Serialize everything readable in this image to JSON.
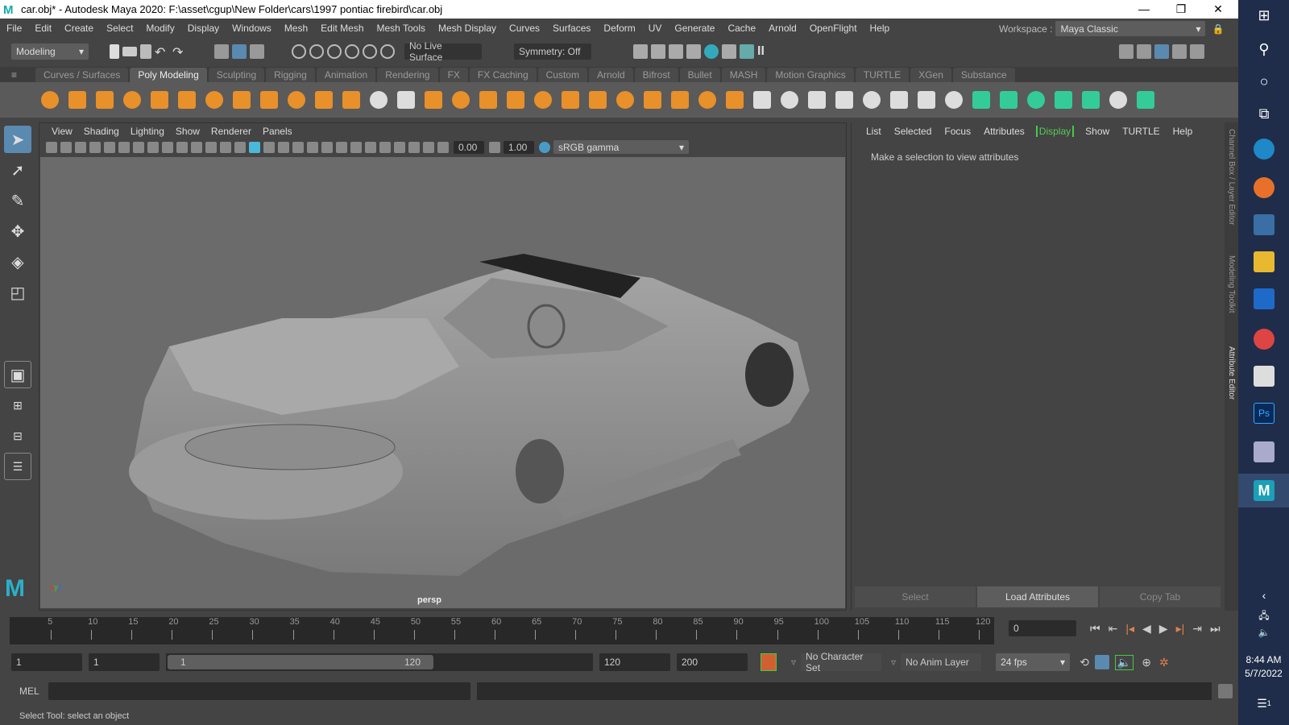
{
  "title": "car.obj* - Autodesk Maya 2020: F:\\asset\\cgup\\New Folder\\cars\\1997 pontiac firebird\\car.obj",
  "window_controls": {
    "minimize": "—",
    "restore": "❐",
    "close": "✕"
  },
  "menu": [
    "File",
    "Edit",
    "Create",
    "Select",
    "Modify",
    "Display",
    "Windows",
    "Mesh",
    "Edit Mesh",
    "Mesh Tools",
    "Mesh Display",
    "Curves",
    "Surfaces",
    "Deform",
    "UV",
    "Generate",
    "Cache",
    "Arnold",
    "OpenFlight",
    "Help"
  ],
  "workspace": {
    "label": "Workspace :",
    "value": "Maya Classic"
  },
  "status": {
    "menu_set": "Modeling",
    "live_surface": "No Live Surface",
    "symmetry": "Symmetry: Off"
  },
  "shelf_tabs": [
    "Curves / Surfaces",
    "Poly Modeling",
    "Sculpting",
    "Rigging",
    "Animation",
    "Rendering",
    "FX",
    "FX Caching",
    "Custom",
    "Arnold",
    "Bifrost",
    "Bullet",
    "MASH",
    "Motion Graphics",
    "TURTLE",
    "XGen",
    "Substance"
  ],
  "active_shelf_tab": 1,
  "shelf_icons": [
    "poly-sphere",
    "poly-cube",
    "poly-cylinder",
    "poly-cone",
    "poly-torus",
    "poly-plane",
    "poly-disc",
    "platonic",
    "super-shape",
    "type",
    "svg",
    "combine",
    "separate",
    "extract",
    "booleans",
    "smooth",
    "average",
    "bridge",
    "append",
    "fill-hole",
    "multi-cut",
    "extrude",
    "bevel",
    "offset",
    "wedge",
    "poke",
    "merge",
    "target-weld",
    "quad-draw",
    "slide-edge",
    "insert-edge-loop",
    "mirror",
    "reduce",
    "retopologize",
    "planar-uv",
    "automatic-uv",
    "unfold",
    "layout",
    "cut-uv",
    "sew-uv",
    "uv-editor"
  ],
  "viewport": {
    "menu": [
      "View",
      "Shading",
      "Lighting",
      "Show",
      "Renderer",
      "Panels"
    ],
    "exposure": "0.00",
    "gamma": "1.00",
    "color_space": "sRGB gamma",
    "camera": "persp"
  },
  "attribute_editor": {
    "menu": [
      "List",
      "Selected",
      "Focus",
      "Attributes",
      "Display",
      "Show",
      "TURTLE",
      "Help"
    ],
    "highlighted": "Display",
    "message": "Make a selection to view attributes",
    "buttons": {
      "select": "Select",
      "load": "Load Attributes",
      "copy": "Copy Tab"
    }
  },
  "side_tabs": [
    "Channel Box / Layer Editor",
    "Modeling Toolkit",
    "Attribute Editor"
  ],
  "timeline": {
    "ticks": [
      5,
      10,
      15,
      20,
      25,
      30,
      35,
      40,
      45,
      50,
      55,
      60,
      65,
      70,
      75,
      80,
      85,
      90,
      95,
      100,
      105,
      110,
      115,
      120
    ],
    "current_frame": "0"
  },
  "range": {
    "start": "1",
    "playback_start": "1",
    "slider_start": "1",
    "slider_end": "120",
    "playback_end": "120",
    "end": "200",
    "character_set": "No Character Set",
    "anim_layer": "No Anim Layer",
    "fps": "24 fps"
  },
  "command": {
    "label": "MEL"
  },
  "help_line": "Select Tool: select an object",
  "clock": {
    "time": "8:44 AM",
    "date": "5/7/2022"
  },
  "notification_count": "1"
}
